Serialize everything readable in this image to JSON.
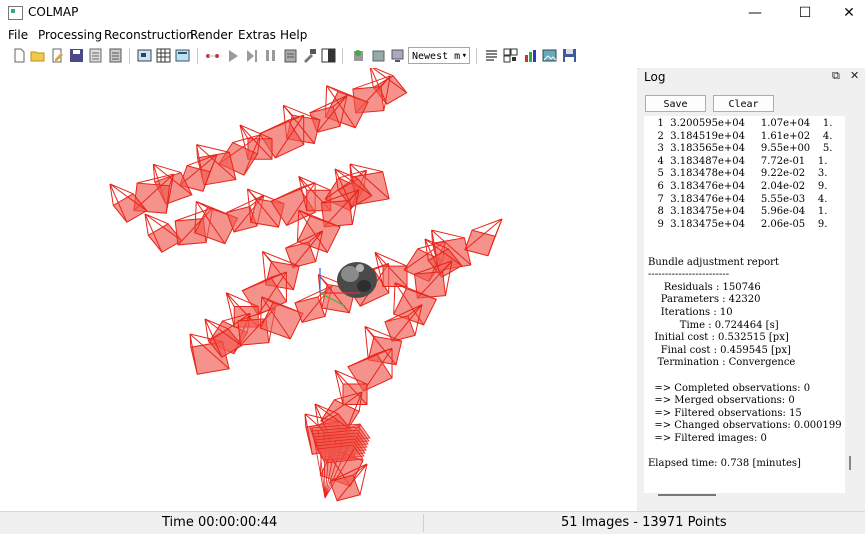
{
  "window": {
    "title": "COLMAP",
    "minimize": "—",
    "maximize": "☐",
    "close": "✕"
  },
  "menu": [
    "File",
    "Processing",
    "Reconstruction",
    "Render",
    "Extras",
    "Help"
  ],
  "toolbar": {
    "icons": [
      "new-project-icon",
      "open-project-icon",
      "edit-project-icon",
      "save-project-icon",
      "import-model-icon",
      "export-model-icon",
      "feature-extraction-icon",
      "feature-matching-icon",
      "database-management-icon",
      "reconstruction-start-icon",
      "reconstruction-step-icon",
      "reconstruction-pause-icon",
      "reconstruction-stop-icon",
      "reconstruction-options-icon",
      "bundle-adjustment-icon",
      "render-toggle-icon",
      "reconstruction-stats-icon",
      "match-matrix-icon",
      "log-icon",
      "undistort-icon",
      "cluster-icon",
      "save-icon"
    ],
    "model_select": "Newest m"
  },
  "log_panel": {
    "title": "Log",
    "float_icon": "⧉",
    "close_icon": "✕",
    "save_label": "Save",
    "clear_label": "Clear",
    "lines": [
      "   1  3.200595e+04     1.07e+04    1.",
      "   2  3.184519e+04     1.61e+02    4.",
      "   3  3.183565e+04     9.55e+00    5.",
      "   4  3.183487e+04     7.72e-01    1.",
      "   5  3.183478e+04     9.22e-02    3.",
      "   6  3.183476e+04     2.04e-02    9.",
      "   7  3.183476e+04     5.55e-03    4.",
      "   8  3.183475e+04     5.96e-04    1.",
      "   9  3.183475e+04     2.06e-05    9.",
      "",
      "",
      "Bundle adjustment report",
      "------------------------",
      "     Residuals : 150746",
      "    Parameters : 42320",
      "    Iterations : 10",
      "          Time : 0.724464 [s]",
      "  Initial cost : 0.532515 [px]",
      "    Final cost : 0.459545 [px]",
      "   Termination : Convergence",
      "",
      "  => Completed observations: 0",
      "  => Merged observations: 0",
      "  => Filtered observations: 15",
      "  => Changed observations: 0.000199",
      "  => Filtered images: 0",
      "",
      "Elapsed time: 0.738 [minutes]"
    ]
  },
  "status": {
    "time": "Time 00:00:00:44",
    "counts": "51 Images - 13971 Points"
  },
  "colors": {
    "camera_red": "#e8241a",
    "camera_fill": "#f0574e"
  }
}
